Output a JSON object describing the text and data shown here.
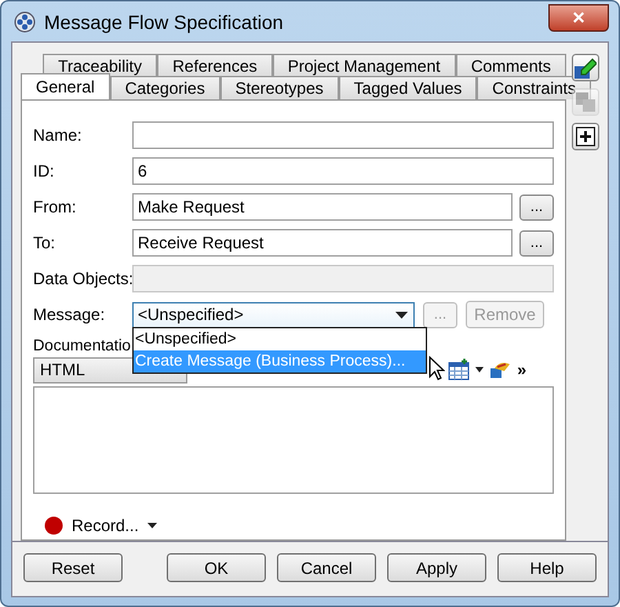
{
  "window": {
    "title": "Message Flow Specification",
    "close": "✕"
  },
  "tabs": [
    [
      {
        "label": "Traceability",
        "selected": false
      },
      {
        "label": "References",
        "selected": false
      },
      {
        "label": "Project Management",
        "selected": false
      },
      {
        "label": "Comments",
        "selected": false
      }
    ],
    [
      {
        "label": "General",
        "selected": true
      },
      {
        "label": "Categories",
        "selected": false
      },
      {
        "label": "Stereotypes",
        "selected": false
      },
      {
        "label": "Tagged Values",
        "selected": false
      },
      {
        "label": "Constraints",
        "selected": false
      }
    ]
  ],
  "fields": [
    {
      "label": "Name:",
      "disabled": false
    },
    {
      "label": "ID:",
      "value": "6",
      "disabled": false
    },
    {
      "label": "From:",
      "value": "Make Request",
      "disabled": false,
      "button": "..."
    },
    {
      "label": "To:",
      "value": "Receive Request",
      "disabled": false,
      "button": "..."
    },
    {
      "label": "Data Objects:",
      "disabled": true
    }
  ],
  "message": {
    "label": "Message:",
    "value": "<Unspecified>",
    "browse": {
      "label": "...",
      "disabled": true
    },
    "remove": {
      "label": "Remove",
      "disabled": true
    },
    "options": [
      {
        "label": "<Unspecified>",
        "highlighted": false
      },
      {
        "label": "Create Message (Business Process)...",
        "highlighted": true
      }
    ]
  },
  "documentation": {
    "label": "Documentatio",
    "format": "HTML",
    "more": "»"
  },
  "record": {
    "label": "Record..."
  },
  "side_buttons": [
    {
      "kind": "edit",
      "disabled": false
    },
    {
      "kind": "copy",
      "disabled": true
    },
    {
      "kind": "add",
      "disabled": false
    }
  ],
  "buttons": [
    "Reset",
    "OK",
    "Cancel",
    "Apply",
    "Help"
  ]
}
